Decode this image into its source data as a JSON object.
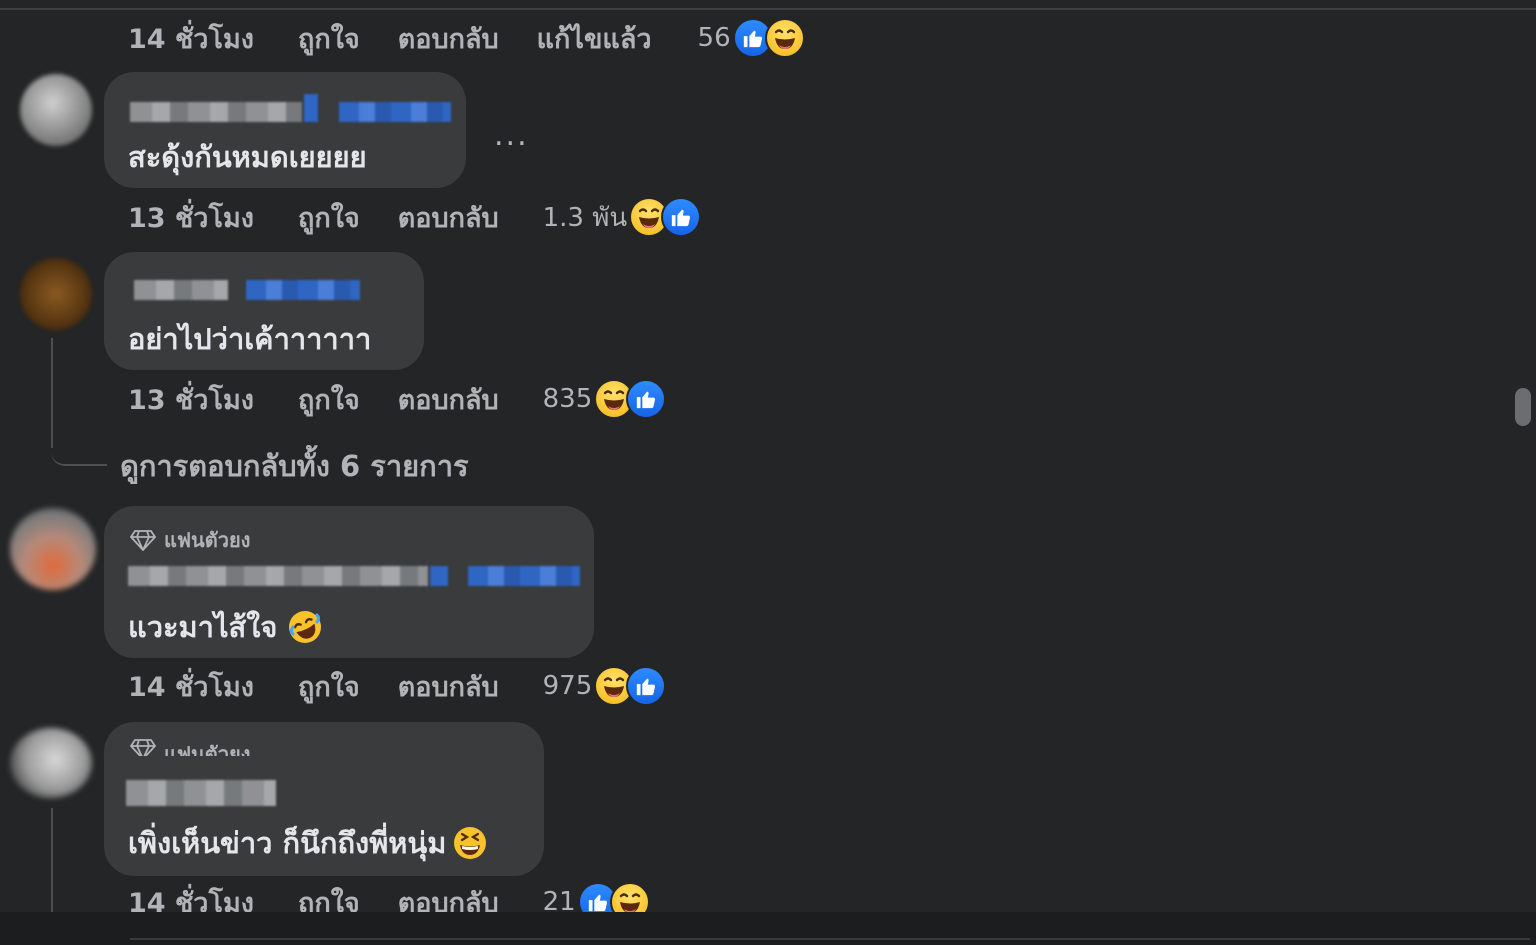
{
  "comments": [
    {
      "id": "c0",
      "time": "14 ชั่วโมง",
      "like": "ถูกใจ",
      "reply": "ตอบกลับ",
      "edited": "แก้ไขแล้ว",
      "count": "56"
    },
    {
      "id": "c1",
      "text": "สะดุ้งกันหมดเยยยย",
      "time": "13 ชั่วโมง",
      "like": "ถูกใจ",
      "reply": "ตอบกลับ",
      "count": "1.3 พัน",
      "more": "..."
    },
    {
      "id": "c2",
      "text": "อย่าไปว่าเค้าาาาาา",
      "time": "13 ชั่วโมง",
      "like": "ถูกใจ",
      "reply": "ตอบกลับ",
      "count": "835"
    },
    {
      "id": "c3",
      "badge": "แฟนตัวยง",
      "text": "แวะมาไส้ใจ",
      "time": "14 ชั่วโมง",
      "like": "ถูกใจ",
      "reply": "ตอบกลับ",
      "count": "975"
    },
    {
      "id": "c4",
      "badge": "แฟนตัวยง",
      "text": "เพิ่งเห็นข่าว ก็นึกถึงพี่หนุ่ม",
      "time": "14 ชั่วโมง",
      "like": "ถูกใจ",
      "reply": "ตอบกลับ",
      "count": "21"
    }
  ],
  "view_replies": "ดูการตอบกลับทั้ง 6 รายการ",
  "colors": {
    "background": "#242526",
    "bubble": "#3a3b3c",
    "muted_text": "#b0b3b8",
    "like_blue": "#1877f2",
    "haha_yellow": "#f7c22b"
  },
  "icons": {
    "like": "thumbs-up-icon",
    "haha": "laughing-face-icon",
    "rofl": "rolling-laughing-icon",
    "grin": "grinning-face-icon",
    "badge": "diamond-icon",
    "more": "ellipsis-icon"
  }
}
